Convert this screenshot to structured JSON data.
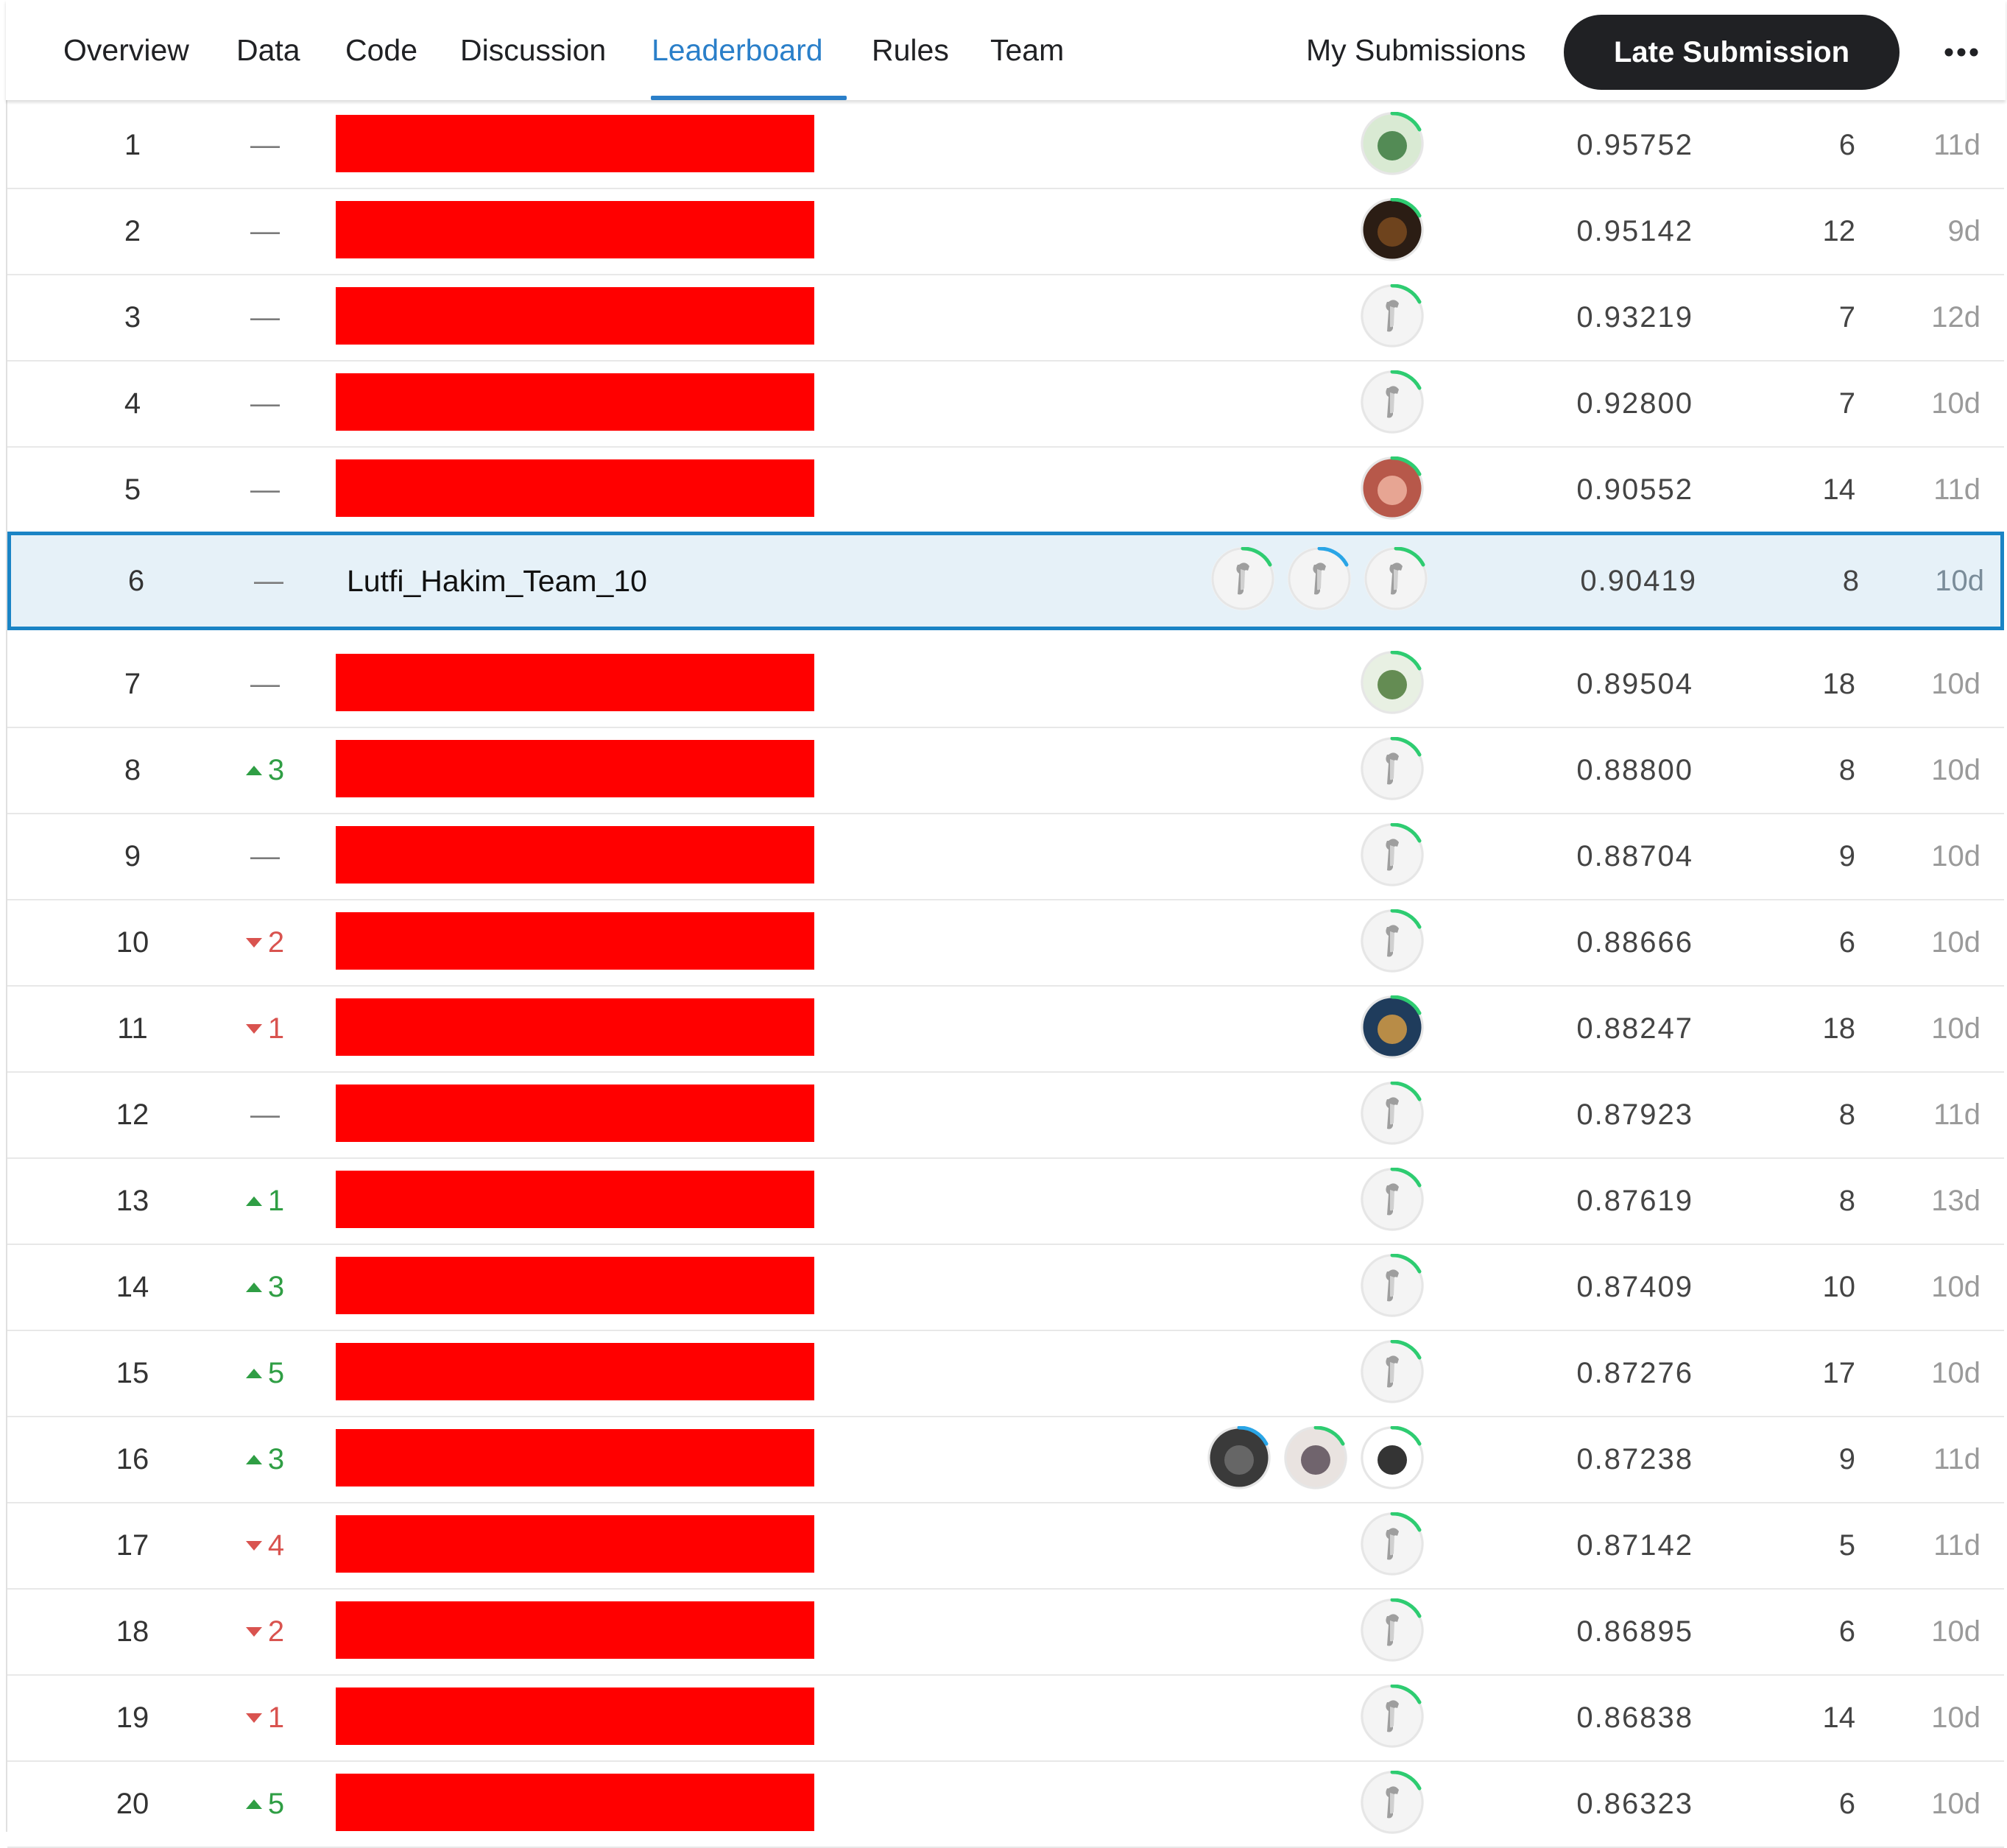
{
  "nav": {
    "tabs": [
      {
        "label": "Overview",
        "active": false
      },
      {
        "label": "Data",
        "active": false
      },
      {
        "label": "Code",
        "active": false
      },
      {
        "label": "Discussion",
        "active": false
      },
      {
        "label": "Leaderboard",
        "active": true
      },
      {
        "label": "Rules",
        "active": false
      },
      {
        "label": "Team",
        "active": false
      }
    ],
    "my_submissions": "My Submissions",
    "late_submission": "Late Submission",
    "more_icon": "more-horizontal-icon"
  },
  "colors": {
    "accent": "#2a7fc9",
    "highlight_bg": "#e6f1f8",
    "highlight_border": "#1a84c5",
    "up": "#2f9e44",
    "down": "#d9534f",
    "redaction": "#ff0000",
    "progress_green": "#2ecc71",
    "progress_blue": "#2aa5e6"
  },
  "rows": [
    {
      "rank": "1",
      "change": "—",
      "dir": "same",
      "team": "",
      "redacted": true,
      "score": "0.95752",
      "entries": "6",
      "last": "11d",
      "avatars": [
        "photo-avatar-person-green"
      ]
    },
    {
      "rank": "2",
      "change": "—",
      "dir": "same",
      "team": "",
      "redacted": true,
      "score": "0.95142",
      "entries": "12",
      "last": "9d",
      "avatars": [
        "photo-avatar-dark"
      ]
    },
    {
      "rank": "3",
      "change": "—",
      "dir": "same",
      "team": "",
      "redacted": true,
      "score": "0.93219",
      "entries": "7",
      "last": "12d",
      "avatars": [
        "default-goose-avatar"
      ]
    },
    {
      "rank": "4",
      "change": "—",
      "dir": "same",
      "team": "",
      "redacted": true,
      "score": "0.92800",
      "entries": "7",
      "last": "10d",
      "avatars": [
        "default-goose-avatar"
      ]
    },
    {
      "rank": "5",
      "change": "—",
      "dir": "same",
      "team": "",
      "redacted": true,
      "score": "0.90552",
      "entries": "14",
      "last": "11d",
      "avatars": [
        "photo-avatar-face"
      ]
    },
    {
      "rank": "6",
      "change": "—",
      "dir": "same",
      "team": "Lutfi_Hakim_Team_10",
      "redacted": false,
      "me": true,
      "score": "0.90419",
      "entries": "8",
      "last": "10d",
      "avatars": [
        "default-goose-avatar",
        "default-goose-avatar-blue",
        "default-goose-avatar"
      ]
    },
    {
      "rank": "7",
      "change": "—",
      "dir": "same",
      "team": "",
      "redacted": true,
      "score": "0.89504",
      "entries": "18",
      "last": "10d",
      "avatars": [
        "photo-avatar-green-frog"
      ]
    },
    {
      "rank": "8",
      "change": "3",
      "dir": "up",
      "team": "",
      "redacted": true,
      "score": "0.88800",
      "entries": "8",
      "last": "10d",
      "avatars": [
        "default-goose-avatar"
      ]
    },
    {
      "rank": "9",
      "change": "—",
      "dir": "same",
      "team": "",
      "redacted": true,
      "score": "0.88704",
      "entries": "9",
      "last": "10d",
      "avatars": [
        "default-goose-avatar"
      ]
    },
    {
      "rank": "10",
      "change": "2",
      "dir": "down",
      "team": "",
      "redacted": true,
      "score": "0.88666",
      "entries": "6",
      "last": "10d",
      "avatars": [
        "default-goose-avatar"
      ]
    },
    {
      "rank": "11",
      "change": "1",
      "dir": "down",
      "team": "",
      "redacted": true,
      "score": "0.88247",
      "entries": "18",
      "last": "10d",
      "avatars": [
        "photo-avatar-cartoon"
      ]
    },
    {
      "rank": "12",
      "change": "—",
      "dir": "same",
      "team": "",
      "redacted": true,
      "score": "0.87923",
      "entries": "8",
      "last": "11d",
      "avatars": [
        "default-goose-avatar"
      ]
    },
    {
      "rank": "13",
      "change": "1",
      "dir": "up",
      "team": "",
      "redacted": true,
      "score": "0.87619",
      "entries": "8",
      "last": "13d",
      "avatars": [
        "default-goose-avatar"
      ]
    },
    {
      "rank": "14",
      "change": "3",
      "dir": "up",
      "team": "",
      "redacted": true,
      "score": "0.87409",
      "entries": "10",
      "last": "10d",
      "avatars": [
        "default-goose-avatar"
      ]
    },
    {
      "rank": "15",
      "change": "5",
      "dir": "up",
      "team": "",
      "redacted": true,
      "score": "0.87276",
      "entries": "17",
      "last": "10d",
      "avatars": [
        "default-goose-avatar"
      ]
    },
    {
      "rank": "16",
      "change": "3",
      "dir": "up",
      "team": "",
      "redacted": true,
      "score": "0.87238",
      "entries": "9",
      "last": "11d",
      "avatars": [
        "photo-avatar-ring-blue",
        "photo-avatar-figure",
        "photo-avatar-panda"
      ]
    },
    {
      "rank": "17",
      "change": "4",
      "dir": "down",
      "team": "",
      "redacted": true,
      "score": "0.87142",
      "entries": "5",
      "last": "11d",
      "avatars": [
        "default-goose-avatar"
      ]
    },
    {
      "rank": "18",
      "change": "2",
      "dir": "down",
      "team": "",
      "redacted": true,
      "score": "0.86895",
      "entries": "6",
      "last": "10d",
      "avatars": [
        "default-goose-avatar"
      ]
    },
    {
      "rank": "19",
      "change": "1",
      "dir": "down",
      "team": "",
      "redacted": true,
      "score": "0.86838",
      "entries": "14",
      "last": "10d",
      "avatars": [
        "default-goose-avatar"
      ]
    },
    {
      "rank": "20",
      "change": "5",
      "dir": "up",
      "team": "",
      "redacted": true,
      "score": "0.86323",
      "entries": "6",
      "last": "10d",
      "avatars": [
        "default-goose-avatar"
      ]
    }
  ]
}
